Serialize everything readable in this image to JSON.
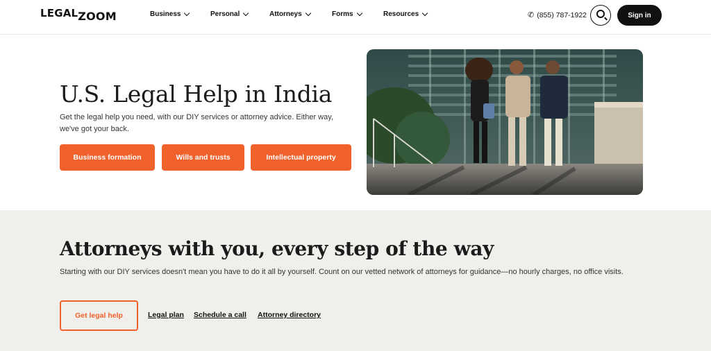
{
  "header": {
    "logo_part1": "LEGAL",
    "logo_part2": "ZOOM",
    "nav": [
      {
        "label": "Business"
      },
      {
        "label": "Personal"
      },
      {
        "label": "Attorneys"
      },
      {
        "label": "Forms"
      },
      {
        "label": "Resources"
      }
    ],
    "phone": "(855) 787-1922",
    "phone_icon": "phone-icon",
    "search_icon": "search-icon",
    "signin_label": "Sign in"
  },
  "hero": {
    "title": "U.S. Legal Help in India",
    "description": "Get the legal help you need, with our DIY services or attorney advice. Either way, we've got your back.",
    "buttons": [
      {
        "label": "Business formation"
      },
      {
        "label": "Wills and trusts"
      },
      {
        "label": "Intellectual property"
      }
    ]
  },
  "attorneys": {
    "title": "Attorneys with you, every step of the way",
    "description": "Starting with our DIY services doesn't mean you have to do it all by yourself. Count on our vetted network of attorneys for guidance—no hourly charges, no office visits.",
    "cta_label": "Get legal help",
    "links": [
      {
        "label": "Legal plan"
      },
      {
        "label": "Schedule a call"
      },
      {
        "label": "Attorney directory"
      }
    ]
  },
  "colors": {
    "accent": "#f0612c",
    "section_bg": "#f1efeb",
    "dark": "#111111"
  }
}
